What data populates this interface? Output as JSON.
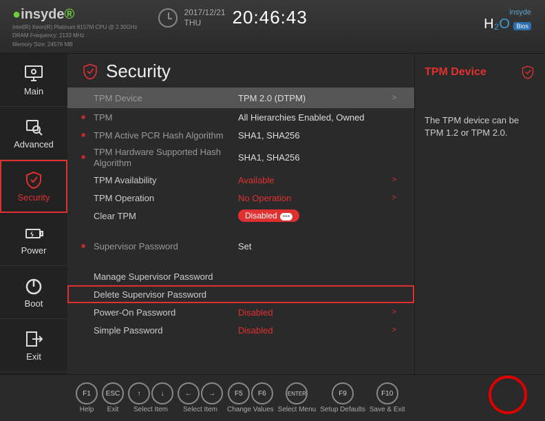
{
  "header": {
    "brand": "insyde",
    "sys_line1": "Intel(R) Xeon(R) Platinum 8157M CPU @ 2.30GHz",
    "sys_line2": "DRAM Frequency: 2133 MHz",
    "sys_line3": "Memory Size: 24576 MB",
    "date": "2017/12/21",
    "day": "THU",
    "time": "20:46:43",
    "right_brand_top": "insyde",
    "right_brand_main": "H₂O",
    "right_brand_badge": "Bios"
  },
  "nav": {
    "main": "Main",
    "advanced": "Advanced",
    "security": "Security",
    "power": "Power",
    "boot": "Boot",
    "exit": "Exit"
  },
  "page": {
    "title": "Security"
  },
  "rows": {
    "tpm_device_label": "TPM Device",
    "tpm_device_value": "TPM 2.0 (DTPM)",
    "tpm_label": "TPM",
    "tpm_value": "All Hierarchies Enabled, Owned",
    "tpm_pcr_label": "TPM Active PCR Hash Algorithm",
    "tpm_pcr_value": "SHA1, SHA256",
    "tpm_hw_label": "TPM Hardware Supported Hash Algorithm",
    "tpm_hw_value": "SHA1, SHA256",
    "tpm_avail_label": "TPM Availability",
    "tpm_avail_value": "Available",
    "tpm_op_label": "TPM Operation",
    "tpm_op_value": "No Operation",
    "clear_tpm_label": "Clear TPM",
    "clear_tpm_value": "Disabled",
    "supervisor_pw_label": "Supervisor Password",
    "supervisor_pw_value": "Set",
    "manage_pw": "Manage Supervisor Password",
    "delete_pw": "Delete Supervisor Password",
    "poweron_pw_label": "Power-On Password",
    "poweron_pw_value": "Disabled",
    "simple_pw_label": "Simple Password",
    "simple_pw_value": "Disabled"
  },
  "info": {
    "title": "TPM Device",
    "desc": "The TPM device can be TPM 1.2 or TPM 2.0."
  },
  "footer": {
    "f1": "F1",
    "f1_label": "Help",
    "esc": "ESC",
    "esc_label": "Exit",
    "up": "↑",
    "down": "↓",
    "selectitem1": "Select Item",
    "left": "←",
    "right": "→",
    "selectitem2": "Select Item",
    "f5": "F5",
    "f6": "F6",
    "changevalues": "Change Values",
    "enter": "ENTER",
    "selectmenu": "Select Menu",
    "f9": "F9",
    "setupdefaults": "Setup Defaults",
    "f10": "F10",
    "saveexit": "Save & Exit"
  }
}
